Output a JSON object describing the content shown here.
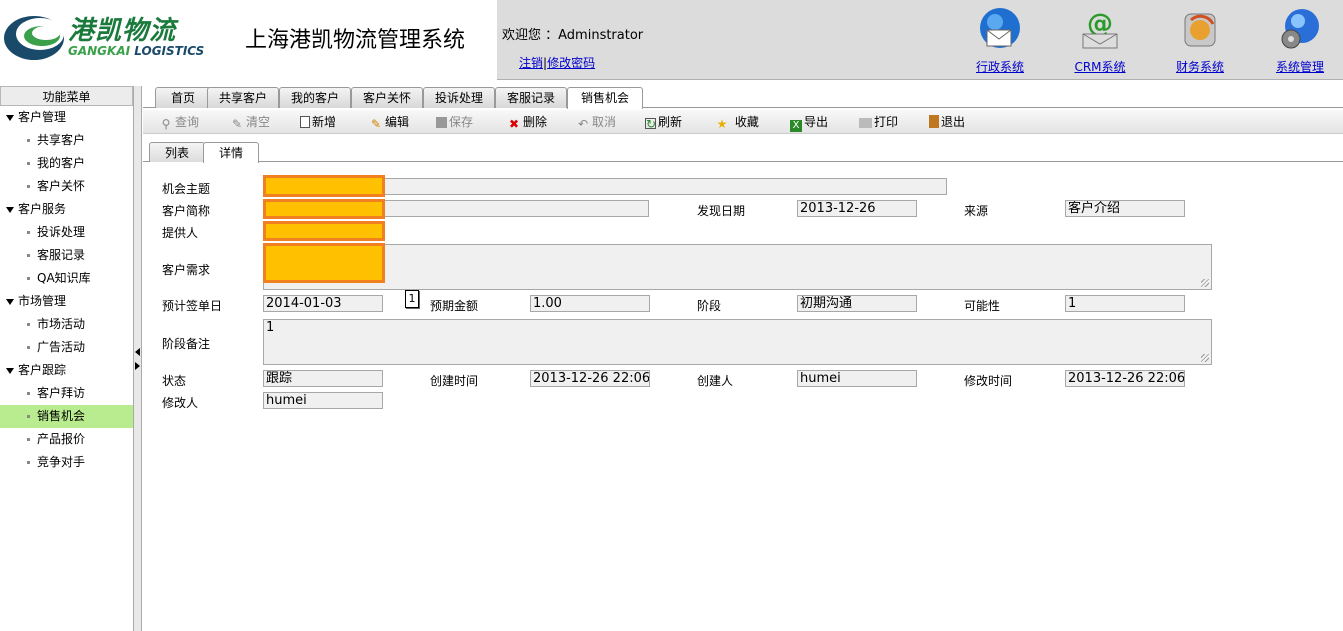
{
  "header": {
    "logo_cn": "港凯物流",
    "logo_en_a": "GANGKAI",
    "logo_en_b": " LOGISTICS",
    "title": "上海港凯物流管理系统",
    "welcome": "欢迎您 ：Adminstrator",
    "logout": "注销",
    "separator": "|",
    "change_password": "修改密码",
    "systems": [
      {
        "label": "行政系统",
        "icon": "mail-globe-icon"
      },
      {
        "label": "CRM系统",
        "icon": "email-at-icon"
      },
      {
        "label": "财务系统",
        "icon": "finance-refresh-icon"
      },
      {
        "label": "系统管理",
        "icon": "gear-globe-icon"
      }
    ]
  },
  "sidebar": {
    "title": "功能菜单",
    "groups": [
      {
        "label": "客户管理",
        "items": [
          "共享客户",
          "我的客户",
          "客户关怀"
        ]
      },
      {
        "label": "客户服务",
        "items": [
          "投诉处理",
          "客服记录",
          "QA知识库"
        ]
      },
      {
        "label": "市场管理",
        "items": [
          "市场活动",
          "广告活动"
        ]
      },
      {
        "label": "客户跟踪",
        "items": [
          "客户拜访",
          "销售机会",
          "产品报价",
          "竞争对手"
        ]
      }
    ],
    "active_item": "销售机会"
  },
  "tabs": [
    "首页",
    "共享客户",
    "我的客户",
    "客户关怀",
    "投诉处理",
    "客服记录",
    "销售机会"
  ],
  "toolbar": {
    "query": "查询",
    "clear": "清空",
    "add": "新增",
    "edit": "编辑",
    "save": "保存",
    "delete": "删除",
    "cancel": "取消",
    "refresh": "刷新",
    "favorite": "收藏",
    "export": "导出",
    "print": "打印",
    "exit": "退出"
  },
  "subtabs": [
    "列表",
    "详情"
  ],
  "form": {
    "subject_label": "机会主题",
    "customer_label": "客户简称",
    "found_date_label": "发现日期",
    "found_date": "2013-12-26",
    "source_label": "来源",
    "source": "客户介绍",
    "provider_label": "提供人",
    "need_label": "客户需求",
    "sign_date_label": "预计签单日",
    "sign_date": "2014-01-03",
    "tooltip": "1",
    "amount_label": "预期金额",
    "amount": "1.00",
    "stage_label": "阶段",
    "stage": "初期沟通",
    "possibility_label": "可能性",
    "possibility": "1",
    "stage_note_label": "阶段备注",
    "stage_note": "1",
    "status_label": "状态",
    "status": "跟踪",
    "created_time_label": "创建时间",
    "created_time": "2013-12-26 22:06",
    "creator_label": "创建人",
    "creator": "humei",
    "modified_time_label": "修改时间",
    "modified_time": "2013-12-26 22:06",
    "modifier_label": "修改人",
    "modifier": "humei"
  }
}
